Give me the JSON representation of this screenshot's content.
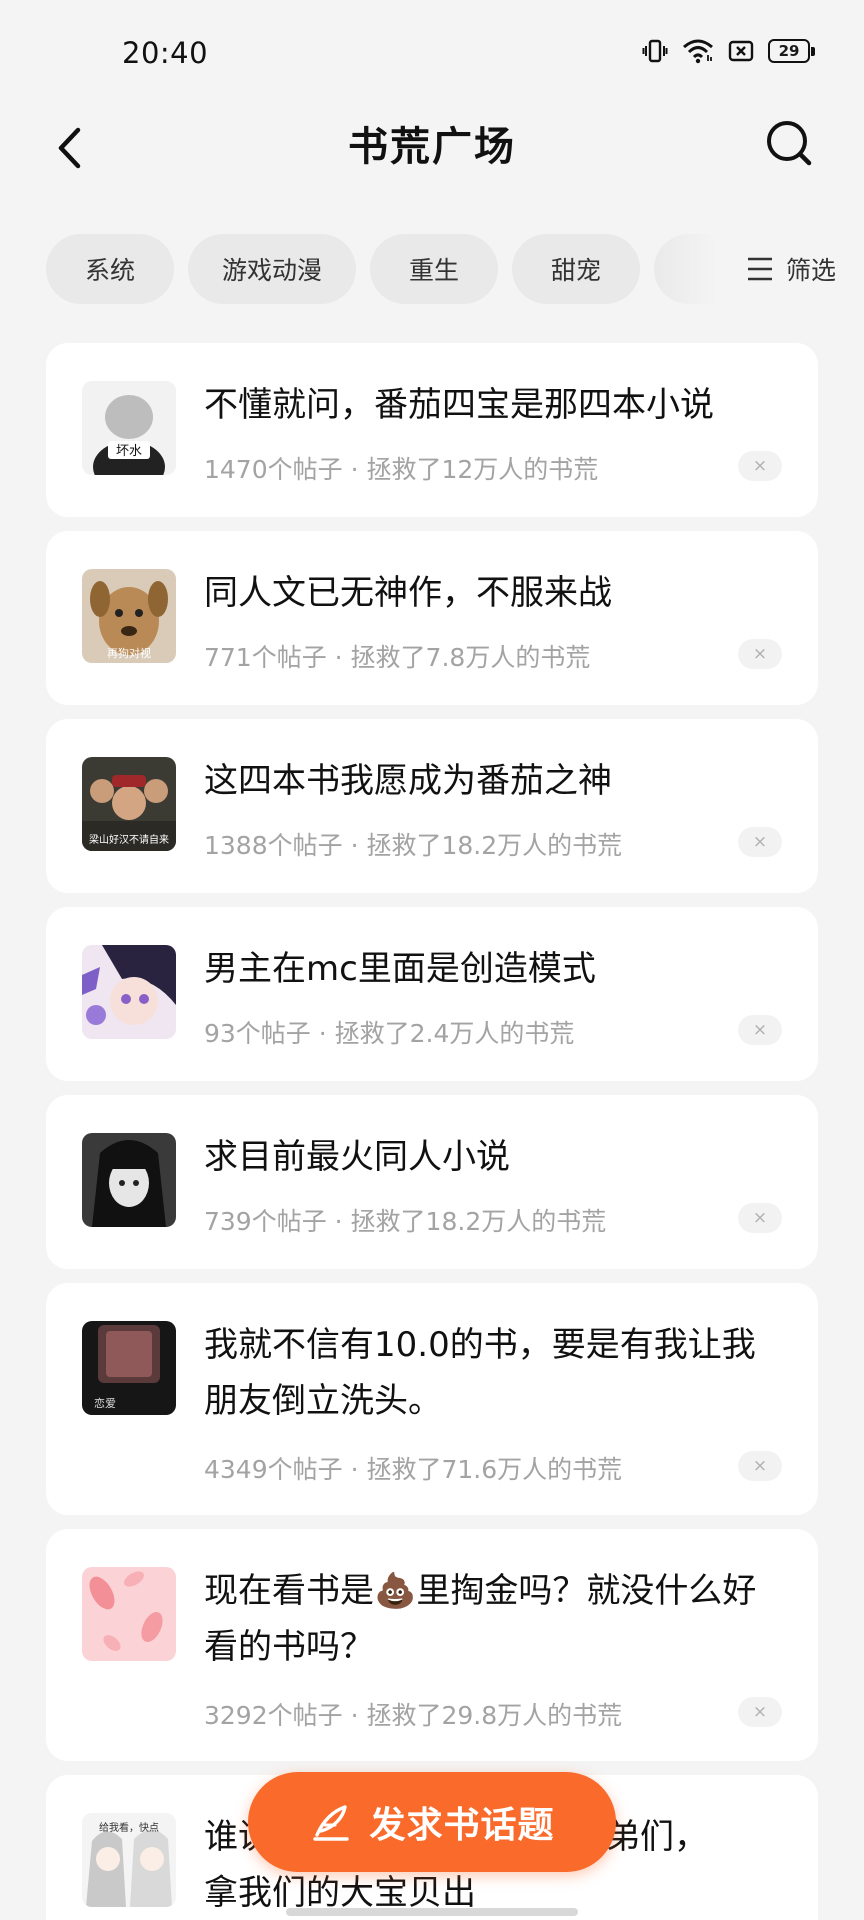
{
  "status_bar": {
    "time": "20:40",
    "battery": "29",
    "icons": [
      "vibrate-icon",
      "wifi-icon",
      "sim-off-icon",
      "battery-icon"
    ]
  },
  "header": {
    "title": "书荒广场",
    "back_icon": "chevron-left-icon",
    "search_icon": "search-icon"
  },
  "chips": [
    {
      "label": "系统"
    },
    {
      "label": "游戏动漫"
    },
    {
      "label": "重生"
    },
    {
      "label": "甜宠"
    }
  ],
  "filter": {
    "label": "筛选",
    "icon": "menu-lines-icon"
  },
  "topics": [
    {
      "title": "不懂就问，番茄四宝是那四本小说",
      "meta": "1470个帖子 · 拯救了12万人的书荒",
      "thumb_text": "坏水"
    },
    {
      "title": "同人文已无神作，不服来战",
      "meta": "771个帖子 · 拯救了7.8万人的书荒",
      "thumb_text": "再狗对视"
    },
    {
      "title": "这四本书我愿成为番茄之神",
      "meta": "1388个帖子 · 拯救了18.2万人的书荒",
      "thumb_text": "梁山好汉不请自来"
    },
    {
      "title": "男主在mc里面是创造模式",
      "meta": "93个帖子 · 拯救了2.4万人的书荒",
      "thumb_text": ""
    },
    {
      "title": "求目前最火同人小说",
      "meta": "739个帖子 · 拯救了18.2万人的书荒",
      "thumb_text": ""
    },
    {
      "title": "我就不信有10.0的书，要是有我让我朋友倒立洗头。",
      "meta": "4349个帖子 · 拯救了71.6万人的书荒",
      "thumb_text": "恋爱"
    },
    {
      "title": "现在看书是💩里掏金吗？就没什么好看的书吗？",
      "meta": "3292个帖子 · 拯救了29.8万人的书荒",
      "thumb_text": ""
    },
    {
      "title": "谁说",
      "title_tail": "兄弟们，",
      "title_line2": "拿我们的大宝贝出",
      "meta": "",
      "thumb_text": "给我看，快点"
    }
  ],
  "dismiss_symbol": "×",
  "fab": {
    "label": "发求书话题",
    "icon": "pen-icon"
  },
  "colors": {
    "accent": "#fa6a2b",
    "background": "#f4f4f4",
    "card": "#ffffff",
    "meta_text": "#a3a3a3"
  }
}
